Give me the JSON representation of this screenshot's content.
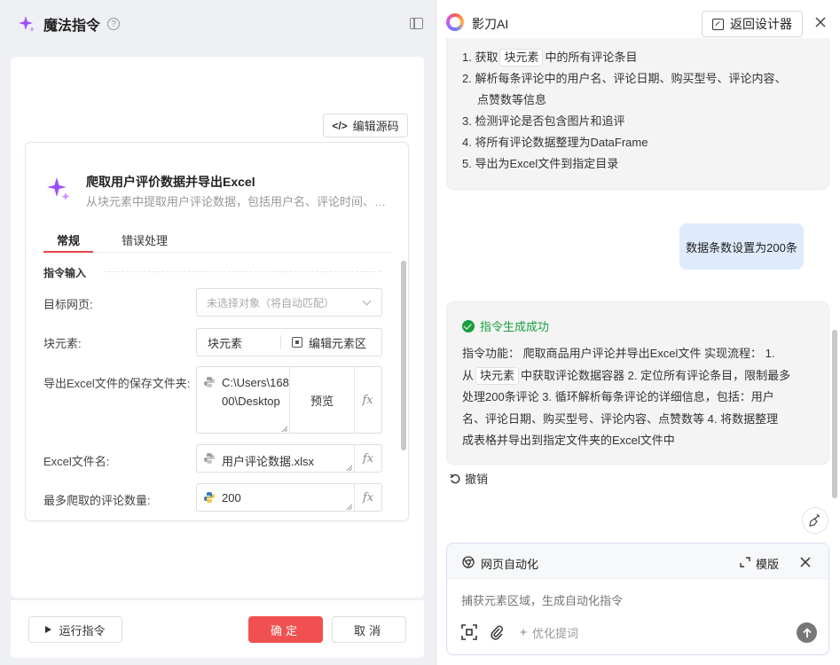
{
  "left": {
    "title": "魔法指令",
    "help": "?",
    "edit_source": "编辑源码",
    "command": {
      "title": "爬取用户评价数据并导出Excel",
      "description": "从块元素中提取用户评论数据，包括用户名、评论时间、购买型号、评论内容等信息"
    },
    "tabs": [
      "常规",
      "错误处理"
    ],
    "section": "指令输入",
    "fields": {
      "target_page": {
        "label": "目标网页:",
        "placeholder": "未选择对象（将自动匹配）"
      },
      "block": {
        "label": "块元素:",
        "value": "块元素",
        "edit": "编辑元素区"
      },
      "folder": {
        "label": "导出Excel文件的保存文件夹:",
        "value": "C:\\Users\\16800\\Desktop",
        "preview": "预览"
      },
      "filename": {
        "label": "Excel文件名:",
        "value": "用户评论数据.xlsx"
      },
      "max_count": {
        "label": "最多爬取的评论数量:",
        "value": "200"
      }
    },
    "fx": "fx",
    "footer": {
      "run": "运行指令",
      "ok": "确定",
      "cancel": "取消"
    }
  },
  "right": {
    "title": "影刀AI",
    "back": "返回设计器",
    "steps": [
      {
        "pre": "1. 获取",
        "chip": "块元素",
        "post": "中的所有评论条目"
      },
      {
        "pre": "2. 解析每条评论中的用户名、评论日期、购买型号、评论内容、"
      },
      {
        "pre": "点赞数等信息"
      },
      {
        "pre": "3. 检测评论是否包含图片和追评"
      },
      {
        "pre": "4. 将所有评论数据整理为DataFrame"
      },
      {
        "pre": "5. 导出为Excel文件到指定目录"
      }
    ],
    "user_message": "数据条数设置为200条",
    "reply": {
      "status": "指令生成成功",
      "line1": "指令功能： 爬取商品用户评论并导出Excel文件 实现流程： 1.",
      "line2_pre": "从",
      "chip": "块元素",
      "line2_post": "中获取评论数据容器 2. 定位所有评论条目，限制最多",
      "line3": "处理200条评论 3. 循环解析每条评论的详细信息，包括：用户",
      "line4": "名、评论日期、购买型号、评论内容、点赞数等 4. 将数据整理",
      "line5": "成表格并导出到指定文件夹的Excel文件中"
    },
    "undo": "撤销",
    "input": {
      "mode": "网页自动化",
      "template": "模版",
      "placeholder": "捕获元素区域，生成自动化指令",
      "optimize": "优化提词"
    }
  }
}
